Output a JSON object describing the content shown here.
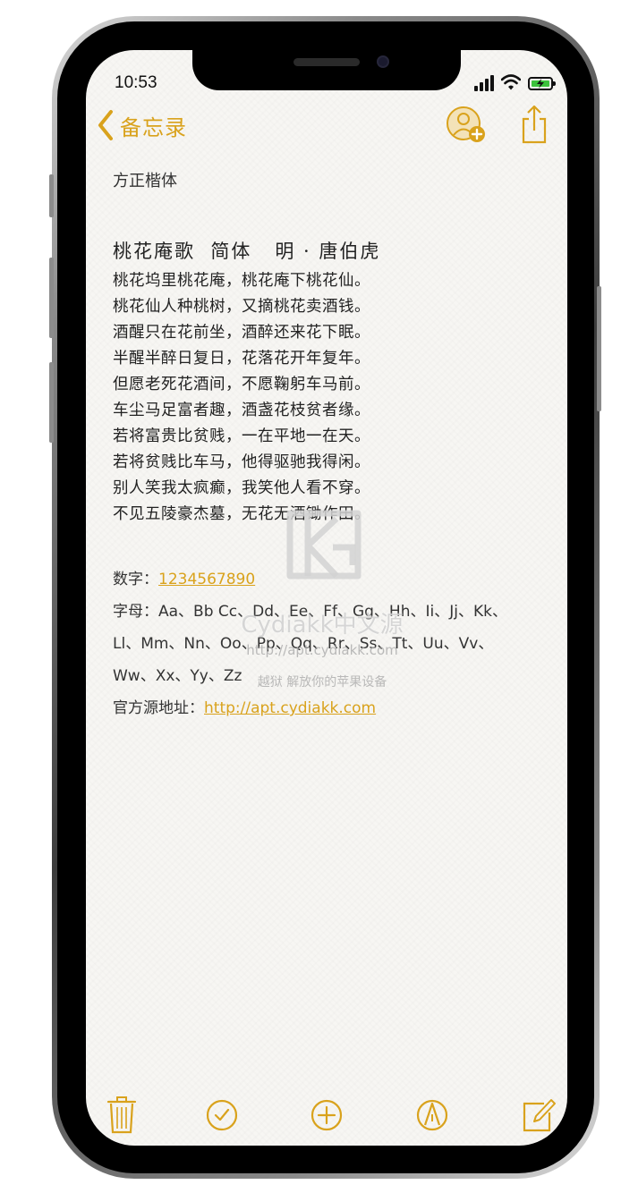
{
  "status": {
    "time": "10:53"
  },
  "nav": {
    "back_label": "备忘录"
  },
  "note": {
    "font_label": "方正楷体",
    "poem_title": "桃花庵歌  简体   明 · 唐伯虎",
    "poem_lines": [
      "桃花坞里桃花庵，桃花庵下桃花仙。",
      "桃花仙人种桃树，又摘桃花卖酒钱。",
      "酒醒只在花前坐，酒醉还来花下眠。",
      "半醒半醉日复日，花落花开年复年。",
      "但愿老死花酒间，不愿鞠躬车马前。",
      "车尘马足富者趣，酒盏花枝贫者缘。",
      "若将富贵比贫贱，一在平地一在天。",
      "若将贫贱比车马，他得驱驰我得闲。",
      "别人笑我太疯癫，我笑他人看不穿。",
      "不见五陵豪杰墓，无花无酒锄作田。"
    ],
    "digits_label": "数字：",
    "digits_value": "1234567890",
    "letters_label": "字母：",
    "letters_line1": "Aa、Bb Cc、Dd、Ee、Ff、Gg、Hh、Ii、Jj、Kk、",
    "letters_line2": "Ll、Mm、Nn、Oo、Pp、Qq、Rr、Ss、Tt、Uu、Vv、",
    "letters_line3": "Ww、Xx、Yy、Zz",
    "source_label": "官方源地址：",
    "source_url": "http://apt.cydiakk.com"
  },
  "watermark": {
    "name": "Cydiakk中文源",
    "url": "http://apt.cydiakk.com",
    "slogan": "越狱 解放你的苹果设备"
  },
  "colors": {
    "accent": "#d9a21c",
    "paper": "#f7f6f3",
    "text": "#222222"
  },
  "icons": {
    "back": "chevron-left-icon",
    "add_person": "add-person-icon",
    "share": "share-icon",
    "trash": "trash-icon",
    "checklist": "checkmark-circle-icon",
    "add": "plus-circle-icon",
    "markup": "markup-pen-icon",
    "compose": "compose-icon"
  }
}
